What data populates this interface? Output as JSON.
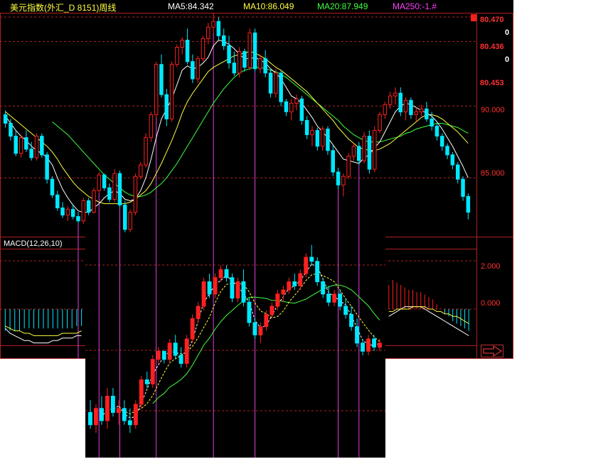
{
  "header": {
    "title": "美元指数(外汇_D 8151)周线",
    "ma5": "MA5:84.342",
    "ma10": "MA10:86.049",
    "ma20": "MA20:87.949",
    "ma250": "MA250:-1.#"
  },
  "colors": {
    "up": "#ff2020",
    "down": "#00e8ff",
    "ma5": "#ffffff",
    "ma10": "#ffff40",
    "ma20": "#40ff40",
    "ma250": "#ff40ff",
    "grid": "#b02020",
    "marker": "#e040e0"
  },
  "axis": {
    "top_value": "80.470",
    "second_value": "0",
    "third_value": "80.436",
    "fourth_value": "0",
    "fifth_value": "80.453",
    "tick_90": "90.000",
    "tick_85": "85.000"
  },
  "macd": {
    "label": "MACD(12,26,10)",
    "tick_2": "2.000",
    "tick_0": "0.000"
  },
  "icons": {
    "scroll": "right-arrow-icon"
  },
  "chart_data": [
    {
      "type": "candlestick",
      "name": "main",
      "ylim": [
        80.9,
        96.5
      ],
      "yticks": [
        85,
        90
      ],
      "candles": [
        [
          89.4,
          89.7,
          88.5,
          88.8
        ],
        [
          88.8,
          89.1,
          87.6,
          87.9
        ],
        [
          87.9,
          88.3,
          86.5,
          86.7
        ],
        [
          86.7,
          88.0,
          86.4,
          87.8
        ],
        [
          87.8,
          88.3,
          86.8,
          87.0
        ],
        [
          87.0,
          87.5,
          86.2,
          86.4
        ],
        [
          86.4,
          88.1,
          86.2,
          87.9
        ],
        [
          87.9,
          88.1,
          86.4,
          86.6
        ],
        [
          86.6,
          86.8,
          84.6,
          84.9
        ],
        [
          84.9,
          85.1,
          83.6,
          83.8
        ],
        [
          83.8,
          84.1,
          82.7,
          82.9
        ],
        [
          82.9,
          83.3,
          82.2,
          82.4
        ],
        [
          82.4,
          83.0,
          82.0,
          82.8
        ],
        [
          82.8,
          83.1,
          82.1,
          82.3
        ],
        [
          82.3,
          82.6,
          81.8,
          82.0
        ],
        [
          82.0,
          83.6,
          81.8,
          83.4
        ],
        [
          83.4,
          83.6,
          82.4,
          82.6
        ],
        [
          82.6,
          84.3,
          82.5,
          84.1
        ],
        [
          84.1,
          85.4,
          83.9,
          85.2
        ],
        [
          85.2,
          85.3,
          84.1,
          84.3
        ],
        [
          84.3,
          84.6,
          83.3,
          83.5
        ],
        [
          83.5,
          85.6,
          83.3,
          85.3
        ],
        [
          85.3,
          85.5,
          82.9,
          83.1
        ],
        [
          83.1,
          83.4,
          81.2,
          81.4
        ],
        [
          81.4,
          82.8,
          81.2,
          82.6
        ],
        [
          82.6,
          85.3,
          82.4,
          85.1
        ],
        [
          85.1,
          86.1,
          84.9,
          85.9
        ],
        [
          85.9,
          88.1,
          85.7,
          87.8
        ],
        [
          87.8,
          89.6,
          87.5,
          89.4
        ],
        [
          89.4,
          93.1,
          89.2,
          92.9
        ],
        [
          92.9,
          93.6,
          90.6,
          90.8
        ],
        [
          90.8,
          91.2,
          88.6,
          89.1
        ],
        [
          89.1,
          93.1,
          88.9,
          92.9
        ],
        [
          92.9,
          94.3,
          92.7,
          94.1
        ],
        [
          94.1,
          94.8,
          93.6,
          94.6
        ],
        [
          94.6,
          95.4,
          92.9,
          93.1
        ],
        [
          93.1,
          93.6,
          91.6,
          91.9
        ],
        [
          91.9,
          93.5,
          91.6,
          93.3
        ],
        [
          93.3,
          94.9,
          93.1,
          94.7
        ],
        [
          94.7,
          95.8,
          94.3,
          95.5
        ],
        [
          95.5,
          96.5,
          95.1,
          95.9
        ],
        [
          95.9,
          96.2,
          94.6,
          94.9
        ],
        [
          94.9,
          95.4,
          93.9,
          94.2
        ],
        [
          94.2,
          94.9,
          92.6,
          93.0
        ],
        [
          93.0,
          93.8,
          92.1,
          92.3
        ],
        [
          92.3,
          94.1,
          92.0,
          93.8
        ],
        [
          93.8,
          94.0,
          92.4,
          92.7
        ],
        [
          92.7,
          95.4,
          92.5,
          95.1
        ],
        [
          95.1,
          95.4,
          92.4,
          92.6
        ],
        [
          92.6,
          93.6,
          92.3,
          93.3
        ],
        [
          93.3,
          93.9,
          92.0,
          92.3
        ],
        [
          92.3,
          92.6,
          90.6,
          90.9
        ],
        [
          90.9,
          92.6,
          90.6,
          92.3
        ],
        [
          92.3,
          92.5,
          90.0,
          90.3
        ],
        [
          90.3,
          90.5,
          89.3,
          89.6
        ],
        [
          89.6,
          90.5,
          89.0,
          90.2
        ],
        [
          90.2,
          90.8,
          89.7,
          90.5
        ],
        [
          90.5,
          90.7,
          88.7,
          89.0
        ],
        [
          89.0,
          89.3,
          87.7,
          88.0
        ],
        [
          88.0,
          88.6,
          87.2,
          88.3
        ],
        [
          88.3,
          88.5,
          86.9,
          87.2
        ],
        [
          87.2,
          88.6,
          86.9,
          88.4
        ],
        [
          88.4,
          88.6,
          86.6,
          86.9
        ],
        [
          86.9,
          87.3,
          85.1,
          85.4
        ],
        [
          85.4,
          85.7,
          84.2,
          84.5
        ],
        [
          84.5,
          85.3,
          83.7,
          85.1
        ],
        [
          85.1,
          86.7,
          84.9,
          86.5
        ],
        [
          86.5,
          87.4,
          86.2,
          87.2
        ],
        [
          87.2,
          87.5,
          85.9,
          86.2
        ],
        [
          86.2,
          88.2,
          86.0,
          87.9
        ],
        [
          87.9,
          88.3,
          85.3,
          85.6
        ],
        [
          85.6,
          88.6,
          85.4,
          88.3
        ],
        [
          88.3,
          89.6,
          88.1,
          89.4
        ],
        [
          89.4,
          90.3,
          89.1,
          90.1
        ],
        [
          90.1,
          91.0,
          89.8,
          90.7
        ],
        [
          90.7,
          91.3,
          90.1,
          90.9
        ],
        [
          90.9,
          91.3,
          89.3,
          89.6
        ],
        [
          89.6,
          90.6,
          89.0,
          90.4
        ],
        [
          90.4,
          90.6,
          89.1,
          89.4
        ],
        [
          89.4,
          89.9,
          88.9,
          89.6
        ],
        [
          89.6,
          90.1,
          89.3,
          89.8
        ],
        [
          89.8,
          90.3,
          88.9,
          89.1
        ],
        [
          89.1,
          89.6,
          88.3,
          88.6
        ],
        [
          88.6,
          88.8,
          87.6,
          87.9
        ],
        [
          87.9,
          88.1,
          86.9,
          87.2
        ],
        [
          87.2,
          87.4,
          86.3,
          86.6
        ],
        [
          86.6,
          86.8,
          85.6,
          85.9
        ],
        [
          85.9,
          86.1,
          84.6,
          84.9
        ],
        [
          84.9,
          85.1,
          83.4,
          83.7
        ],
        [
          83.7,
          83.9,
          82.1,
          82.6
        ]
      ],
      "ma5": [
        89.3,
        88.8,
        88.3,
        87.9,
        87.6,
        87.2,
        86.9,
        86.7,
        86.4,
        85.9,
        85.0,
        84.2,
        83.6,
        83.1,
        82.7,
        82.6,
        82.6,
        82.9,
        83.2,
        83.6,
        83.9,
        84.1,
        83.9,
        83.5,
        83.4,
        83.5,
        84.1,
        85.0,
        86.3,
        87.8,
        89.1,
        89.8,
        90.5,
        91.5,
        92.5,
        92.8,
        92.6,
        92.7,
        93.0,
        93.4,
        94.2,
        94.6,
        94.5,
        94.3,
        94.0,
        93.6,
        93.3,
        93.3,
        93.4,
        93.2,
        93.0,
        92.6,
        92.3,
        91.9,
        91.3,
        90.7,
        90.5,
        90.2,
        89.7,
        89.2,
        88.6,
        88.2,
        87.8,
        87.3,
        86.8,
        86.3,
        86.2,
        86.1,
        86.0,
        86.4,
        86.6,
        87.1,
        87.5,
        88.2,
        88.9,
        89.6,
        90.0,
        90.2,
        90.1,
        89.9,
        89.7,
        89.5,
        89.3,
        88.9,
        88.4,
        87.8,
        87.2,
        86.5,
        85.8,
        85.0
      ],
      "ma10": [
        89.6,
        89.3,
        89.0,
        88.7,
        88.4,
        88.1,
        87.8,
        87.5,
        87.2,
        86.8,
        86.3,
        85.7,
        85.2,
        84.7,
        84.3,
        84.0,
        83.7,
        83.5,
        83.3,
        83.2,
        83.2,
        83.2,
        83.2,
        83.2,
        83.3,
        83.5,
        83.8,
        84.1,
        84.6,
        85.3,
        86.0,
        86.8,
        87.6,
        88.5,
        89.5,
        90.3,
        90.9,
        91.4,
        91.9,
        92.4,
        92.7,
        92.9,
        93.1,
        93.3,
        93.5,
        93.6,
        93.7,
        93.8,
        93.7,
        93.5,
        93.3,
        93.0,
        92.7,
        92.5,
        92.2,
        91.9,
        91.6,
        91.3,
        91.0,
        90.6,
        90.2,
        89.8,
        89.4,
        89.0,
        88.5,
        88.1,
        87.7,
        87.4,
        87.1,
        87.0,
        86.9,
        86.9,
        87.0,
        87.2,
        87.4,
        87.7,
        88.0,
        88.3,
        88.6,
        88.9,
        89.2,
        89.4,
        89.4,
        89.3,
        89.1,
        88.8,
        88.5,
        88.2,
        87.8,
        87.4
      ],
      "ma20": [
        null,
        null,
        null,
        null,
        null,
        null,
        null,
        null,
        null,
        88.9,
        88.6,
        88.3,
        88.0,
        87.6,
        87.2,
        86.8,
        86.4,
        86.0,
        85.6,
        85.2,
        84.9,
        84.6,
        84.3,
        84.0,
        83.8,
        83.7,
        83.7,
        83.8,
        84.0,
        84.3,
        84.6,
        85.0,
        85.5,
        86.0,
        86.6,
        87.2,
        87.8,
        88.4,
        89.0,
        89.6,
        90.2,
        90.7,
        91.2,
        91.6,
        92.0,
        92.3,
        92.5,
        92.6,
        92.7,
        92.7,
        92.6,
        92.5,
        92.4,
        92.2,
        92.0,
        91.7,
        91.4,
        91.1,
        90.8,
        90.5,
        90.2,
        89.9,
        89.6,
        89.3,
        89.0,
        88.6,
        88.3,
        88.0,
        87.8,
        87.6,
        87.5,
        87.5,
        87.5,
        87.6,
        87.7,
        87.8,
        87.9,
        88.1,
        88.2,
        88.4,
        88.5,
        88.6,
        88.7,
        88.8,
        88.8,
        88.7,
        88.6,
        88.5,
        88.3,
        88.1
      ],
      "event_bars": [
        14,
        18,
        22,
        29,
        40,
        48,
        64,
        68
      ]
    },
    {
      "type": "histogram",
      "name": "macd-left",
      "ylim": [
        -1.5,
        2.5
      ],
      "yticks": [
        0,
        2
      ],
      "bars": [
        -0.9,
        -0.9,
        -0.9,
        -0.9,
        -0.8,
        -0.8,
        -0.8,
        -0.8,
        -0.8,
        -0.8,
        -0.8,
        -0.8,
        -0.8,
        -0.8,
        -0.8,
        -0.7,
        -0.7
      ],
      "dif": [
        -0.8,
        -1.0,
        -1.1,
        -1.2,
        -1.3,
        -1.3,
        -1.4,
        -1.4,
        -1.4,
        -1.4,
        -1.3,
        -1.3,
        -1.2,
        -1.2,
        -1.2,
        -1.1,
        -1.1
      ],
      "dea": [
        -0.7,
        -0.8,
        -0.9,
        -0.9,
        -1.0,
        -1.0,
        -1.1,
        -1.1,
        -1.1,
        -1.1,
        -1.1,
        -1.1,
        -1.0,
        -1.0,
        -1.0,
        -1.0,
        -0.9
      ]
    },
    {
      "type": "histogram",
      "name": "macd-right",
      "ylim": [
        -1.5,
        2.5
      ],
      "yticks": [
        0,
        2
      ],
      "bars": [
        1.0,
        1.2,
        1.1,
        1.0,
        0.9,
        0.8,
        0.8,
        0.7,
        0.7,
        0.6,
        0.5,
        0.4,
        0.2,
        0.0,
        -0.2,
        -0.3,
        -0.5,
        -0.6,
        -0.7,
        -0.8,
        -0.9
      ],
      "dif": [
        -0.3,
        -0.2,
        -0.1,
        0.0,
        0.1,
        0.1,
        0.1,
        0.1,
        0.1,
        0.0,
        -0.1,
        -0.2,
        -0.3,
        -0.4,
        -0.5,
        -0.6,
        -0.7,
        -0.8,
        -0.9,
        -1.0,
        -1.1
      ],
      "dea": [
        -0.1,
        -0.1,
        0.0,
        0.0,
        0.0,
        0.0,
        0.1,
        0.1,
        0.1,
        0.1,
        0.0,
        0.0,
        -0.1,
        -0.1,
        -0.2,
        -0.2,
        -0.3,
        -0.3,
        -0.4,
        -0.5,
        -0.6
      ]
    },
    {
      "type": "candlestick",
      "name": "overlay",
      "ylim": [
        -1.0,
        4.2
      ],
      "candles": [
        [
          0.0,
          0.3,
          -0.4,
          -0.3
        ],
        [
          -0.3,
          0.2,
          -0.5,
          0.1
        ],
        [
          0.1,
          0.4,
          -0.3,
          -0.2
        ],
        [
          -0.2,
          0.6,
          -0.4,
          0.4
        ],
        [
          0.4,
          0.6,
          -0.1,
          0.0
        ],
        [
          0.0,
          0.3,
          -0.3,
          0.1
        ],
        [
          0.1,
          0.3,
          -0.3,
          -0.2
        ],
        [
          -0.2,
          0.1,
          -0.5,
          -0.3
        ],
        [
          -0.3,
          0.3,
          -0.4,
          0.2
        ],
        [
          0.2,
          0.9,
          0.1,
          0.8
        ],
        [
          0.8,
          1.0,
          0.6,
          0.7
        ],
        [
          0.7,
          1.4,
          0.6,
          1.3
        ],
        [
          1.3,
          1.6,
          1.2,
          1.5
        ],
        [
          1.5,
          1.5,
          1.2,
          1.3
        ],
        [
          1.3,
          1.8,
          1.2,
          1.7
        ],
        [
          1.7,
          1.9,
          1.3,
          1.4
        ],
        [
          1.4,
          1.6,
          1.1,
          1.2
        ],
        [
          1.2,
          1.9,
          1.1,
          1.8
        ],
        [
          1.8,
          2.4,
          1.7,
          2.3
        ],
        [
          2.3,
          2.7,
          2.2,
          2.6
        ],
        [
          2.6,
          3.3,
          2.5,
          3.2
        ],
        [
          3.2,
          3.4,
          2.8,
          2.9
        ],
        [
          2.9,
          3.4,
          2.8,
          3.3
        ],
        [
          3.3,
          3.6,
          3.2,
          3.5
        ],
        [
          3.5,
          3.6,
          3.2,
          3.3
        ],
        [
          3.3,
          3.4,
          2.7,
          2.8
        ],
        [
          2.8,
          3.3,
          2.7,
          3.2
        ],
        [
          3.2,
          3.5,
          2.6,
          2.7
        ],
        [
          2.7,
          2.8,
          2.1,
          2.2
        ],
        [
          2.2,
          2.3,
          1.8,
          1.9
        ],
        [
          1.9,
          2.2,
          1.7,
          2.1
        ],
        [
          2.1,
          2.5,
          2.0,
          2.4
        ],
        [
          2.4,
          2.7,
          2.3,
          2.6
        ],
        [
          2.6,
          3.0,
          2.5,
          2.9
        ],
        [
          2.9,
          3.1,
          2.7,
          3.0
        ],
        [
          3.0,
          3.3,
          2.9,
          3.2
        ],
        [
          3.2,
          3.4,
          3.0,
          3.1
        ],
        [
          3.1,
          3.5,
          3.0,
          3.4
        ],
        [
          3.4,
          3.9,
          3.3,
          3.8
        ],
        [
          3.8,
          4.1,
          3.6,
          3.7
        ],
        [
          3.7,
          3.8,
          3.1,
          3.2
        ],
        [
          3.2,
          3.3,
          2.8,
          2.9
        ],
        [
          2.9,
          3.1,
          2.6,
          2.7
        ],
        [
          2.7,
          3.0,
          2.6,
          2.9
        ],
        [
          2.9,
          3.0,
          2.5,
          2.6
        ],
        [
          2.6,
          2.8,
          2.3,
          2.4
        ],
        [
          2.4,
          2.6,
          2.0,
          2.1
        ],
        [
          2.1,
          2.3,
          1.6,
          1.7
        ],
        [
          1.7,
          1.8,
          1.4,
          1.5
        ],
        [
          1.5,
          1.9,
          1.4,
          1.8
        ],
        [
          1.8,
          1.9,
          1.5,
          1.6
        ],
        [
          1.6,
          1.8,
          1.5,
          1.7
        ]
      ]
    }
  ]
}
